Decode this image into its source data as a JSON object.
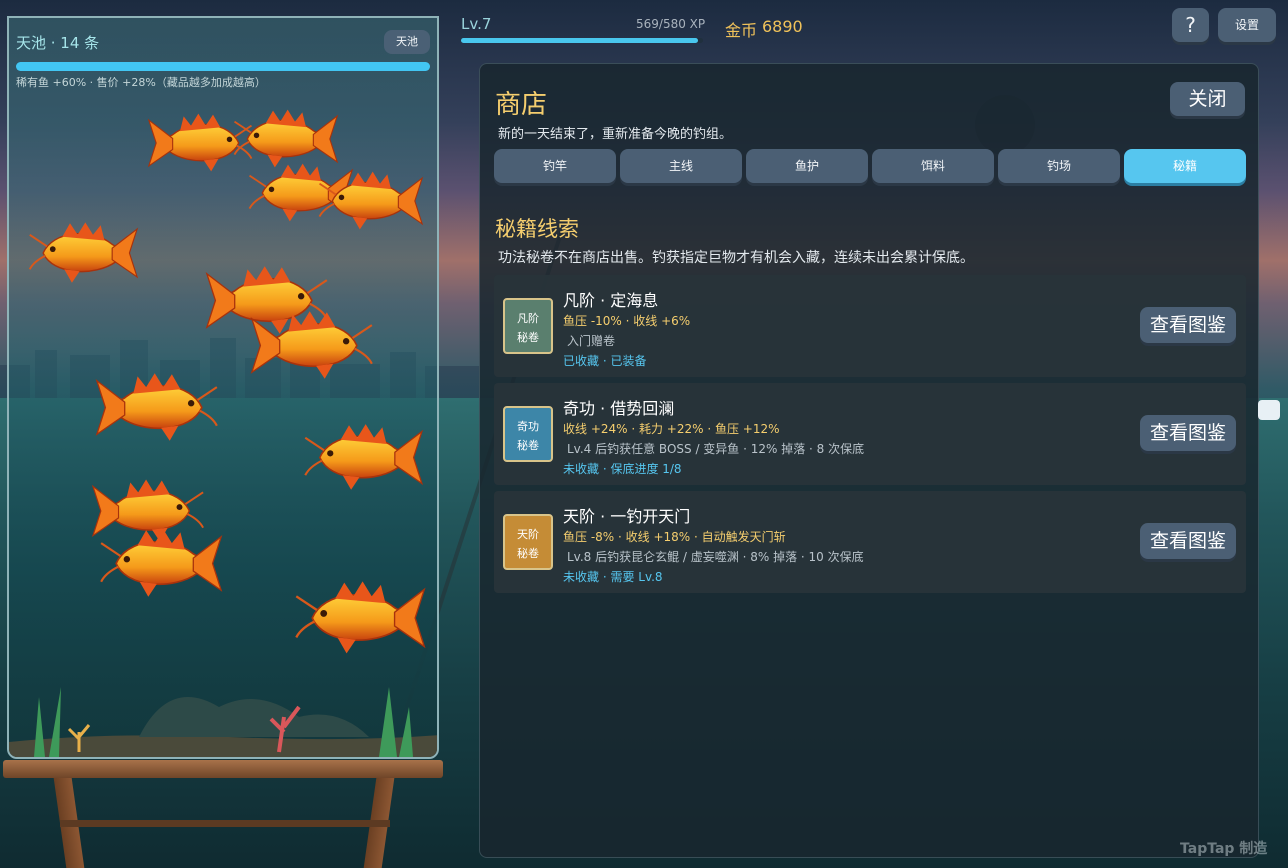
{
  "tank": {
    "title": "天池 · 14 条",
    "badge": "天池",
    "bonus": "稀有鱼 +60% · 售价 +28%（藏品越多加成越高）"
  },
  "hud": {
    "level": "Lv.7",
    "xp": "569/580 XP",
    "xp_progress": 0.981,
    "coin_label": "金币",
    "coin_value": "6890",
    "help_label": "?",
    "settings_label": "设置"
  },
  "shop": {
    "title": "商店",
    "subtitle": "新的一天结束了，重新准备今晚的钓组。",
    "close_label": "关闭",
    "tabs": [
      {
        "label": "钓竿"
      },
      {
        "label": "主线"
      },
      {
        "label": "鱼护"
      },
      {
        "label": "饵料"
      },
      {
        "label": "钓场"
      },
      {
        "label": "秘籍"
      }
    ],
    "active_tab": "秘籍",
    "section_title": "秘籍线索",
    "section_desc": "功法秘卷不在商店出售。钓获指定巨物才有机会入藏，连续未出会累计保底。",
    "items": [
      {
        "badge_top": "凡阶",
        "badge_bottom": "秘卷",
        "name": "凡阶 · 定海息",
        "stats": "鱼压 -10% · 收线 +6%",
        "info": "入门赠卷",
        "status": "已收藏 · 已装备",
        "button": "查看图鉴"
      },
      {
        "badge_top": "奇功",
        "badge_bottom": "秘卷",
        "name": "奇功 · 借势回澜",
        "stats": "收线 +24% · 耗力 +22% · 鱼压 +12%",
        "info": "Lv.4 后钓获任意 BOSS / 变异鱼 · 12% 掉落 · 8 次保底",
        "status": "未收藏 · 保底进度 1/8",
        "button": "查看图鉴"
      },
      {
        "badge_top": "天阶",
        "badge_bottom": "秘卷",
        "name": "天阶 · 一钓开天门",
        "stats": "鱼压 -8% · 收线 +18% · 自动触发天门斩",
        "info": "Lv.8 后钓获昆仑玄鲲 / 虚妄噬渊 · 8% 掉落 · 10 次保底",
        "status": "未收藏 · 需要 Lv.8",
        "button": "查看图鉴"
      }
    ]
  },
  "watermark": "TapTap 制造",
  "colors": {
    "accent": "#56c6ef",
    "gold": "#f5ce6e",
    "button": "#4b5f74"
  }
}
